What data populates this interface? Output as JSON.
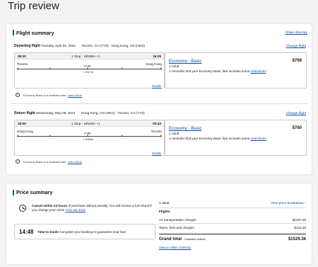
{
  "page_title": "Trip review",
  "flight_summary": {
    "title": "Flight summary",
    "share_label": "Share itinerary",
    "departing": {
      "heading": "Departing flight",
      "date": "Tuesday, April 02, 2024",
      "route": "Toronto, CA (YYZ) - Hong Kong, CN (HKG)",
      "change_label": "Change flight",
      "dep_time": "08:30",
      "stops": "1 Stop - 19h35m +1",
      "arr_time": "16:05",
      "origin": "Toronto",
      "destination": "Hong Kong",
      "connection": "YVR",
      "layover": "+ 1h17m",
      "details_label": "Details",
      "fare_name": "Economy - Basic",
      "price": "$769",
      "passengers": "1 Adult",
      "reminder_text": "A reminder that your Economy Basic fare includes some",
      "restrictions_label": "restrictions",
      "notice": "Economy Basic is a restricted fare.",
      "learn_more": "Learn More"
    },
    "return": {
      "heading": "Return flight",
      "date": "Wednesday, May 08, 2024",
      "route": "Hong Kong, CN (HKG) - Toronto, CA (YYZ)",
      "change_label": "Change flight",
      "dep_time": "18:00",
      "stops": "1 Stop - 18h43m +1",
      "arr_time": "00:43",
      "origin": "Hong Kong",
      "destination": "Toronto",
      "connection": "YVR",
      "layover": "+ 2h45m",
      "details_label": "Details",
      "fare_name": "Economy - Basic",
      "price": "$760",
      "passengers": "1 Adult",
      "reminder_text": "A reminder that your Economy Basic fare includes some",
      "restrictions_label": "restrictions",
      "notice": "Economy Basic is a restricted fare.",
      "learn_more": "Learn More"
    }
  },
  "price_summary": {
    "title": "Price summary",
    "cancel_bold": "Cancel within 24 hours",
    "cancel_text": "of purchase without penalty. You will receive a full refund if you change your mind.",
    "find_out_more": "Find out more",
    "timer": "14:48",
    "timer_bold": "Time to book!",
    "timer_text": "Complete your booking to guarantee your fare.",
    "adults": "1 adult",
    "breakdown_label": "View price breakdown",
    "flights_label": "Flights",
    "rows": [
      {
        "label": "Air transportation charges",
        "value": "$1407.00"
      },
      {
        "label": "Taxes, fees and charges",
        "value": "$122.36"
      }
    ],
    "grand_total_label": "Grand total",
    "currency_note": "- Canadian dollars",
    "grand_total": "$1529.36",
    "other_currency": "View in other currency"
  },
  "colors": {
    "accent": "#0b4ea2"
  }
}
